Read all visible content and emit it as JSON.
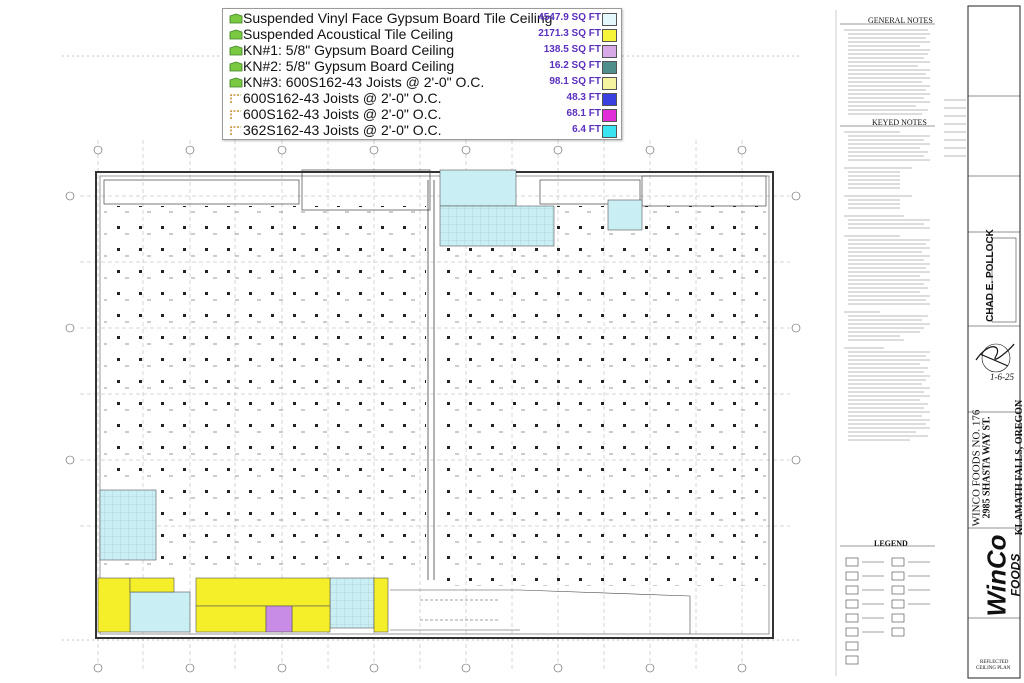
{
  "legend": {
    "rows": [
      {
        "label": "Suspended Vinyl Face Gypsum Board Tile Ceiling",
        "qty": "4547.9 SQ FT",
        "swatch": "#e4f7fb",
        "icon": "green-area-icon",
        "qty_color": "#5a2fc0"
      },
      {
        "label": "Suspended Acoustical Tile Ceiling",
        "qty": "2171.3 SQ FT",
        "swatch": "#f7f53a",
        "icon": "green-area-icon",
        "qty_color": "#5a2fc0"
      },
      {
        "label": "KN#1: 5/8\" Gypsum Board Ceiling",
        "qty": "138.5 SQ FT",
        "swatch": "#d7a9e6",
        "icon": "green-area-icon",
        "qty_color": "#5a2fc0"
      },
      {
        "label": "KN#2: 5/8\" Gypsum Board Ceiling",
        "qty": "16.2 SQ FT",
        "swatch": "#4e8f8b",
        "icon": "green-area-icon",
        "qty_color": "#5a2fc0"
      },
      {
        "label": "KN#3: 600S162-43 Joists @ 2'-0\" O.C.",
        "qty": "98.1 SQ FT",
        "swatch": "#f6f3a0",
        "icon": "green-area-icon",
        "qty_color": "#5a2fc0"
      },
      {
        "label": "600S162-43 Joists @ 2'-0\" O.C.",
        "qty": "48.3 FT",
        "swatch": "#3a40e0",
        "icon": "linear-measure-icon",
        "qty_color": "#5a2fc0"
      },
      {
        "label": "600S162-43 Joists @ 2'-0\" O.C.",
        "qty": "68.1 FT",
        "swatch": "#e02fd8",
        "icon": "linear-measure-icon",
        "qty_color": "#5a2fc0"
      },
      {
        "label": "362S162-43 Joists @ 2'-0\" O.C.",
        "qty": "6.4 FT",
        "swatch": "#39e4f0",
        "icon": "linear-measure-icon",
        "qty_color": "#5a2fc0"
      }
    ]
  },
  "notes": {
    "general_title": "GENERAL NOTES",
    "keyed_title": "KEYED NOTES",
    "legend_title": "LEGEND"
  },
  "title_block": {
    "architect_name": "CHAD E. POLLOCK",
    "signature_date": "1-6-25",
    "project_line1": "WINCO FOODS NO. 176",
    "project_line2": "2985 SHASTA WAY ST.",
    "project_line3": "KLAMATH FALLS, OREGON",
    "logo_line1": "WinCo",
    "logo_line2": "FOODS",
    "sheet_title_line1": "REFLECTED",
    "sheet_title_line2": "CEILING PLAN"
  },
  "colors": {
    "light_blue_fill": "#c9eef4",
    "yellow_fill": "#f5ef2a",
    "purple_fill": "#c88be6",
    "line": "#333333",
    "green_icon": "#7ac943"
  }
}
